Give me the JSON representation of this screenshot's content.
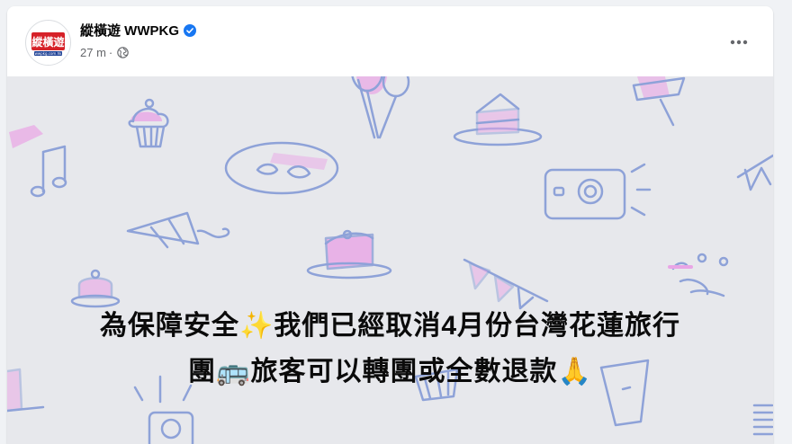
{
  "post": {
    "page_name": "縱橫遊 WWPKG",
    "timestamp": "27 m",
    "separator": "·",
    "avatar_logo_text": "縱橫遊",
    "avatar_logo_sub": "wwpkg.com.hk",
    "line1": "為保障安全✨我們已經取消4月份台灣花蓮旅行",
    "line2": "團🚌旅客可以轉團或全數退款🙏"
  },
  "icons": {
    "verified": "verified-badge-icon",
    "privacy": "globe-icon",
    "more": "more-options-icon"
  },
  "colors": {
    "verified_blue": "#1877f2",
    "logo_red": "#d62128",
    "doodle_blue": "#8ea2d8",
    "doodle_pink": "#e9a5e6"
  }
}
